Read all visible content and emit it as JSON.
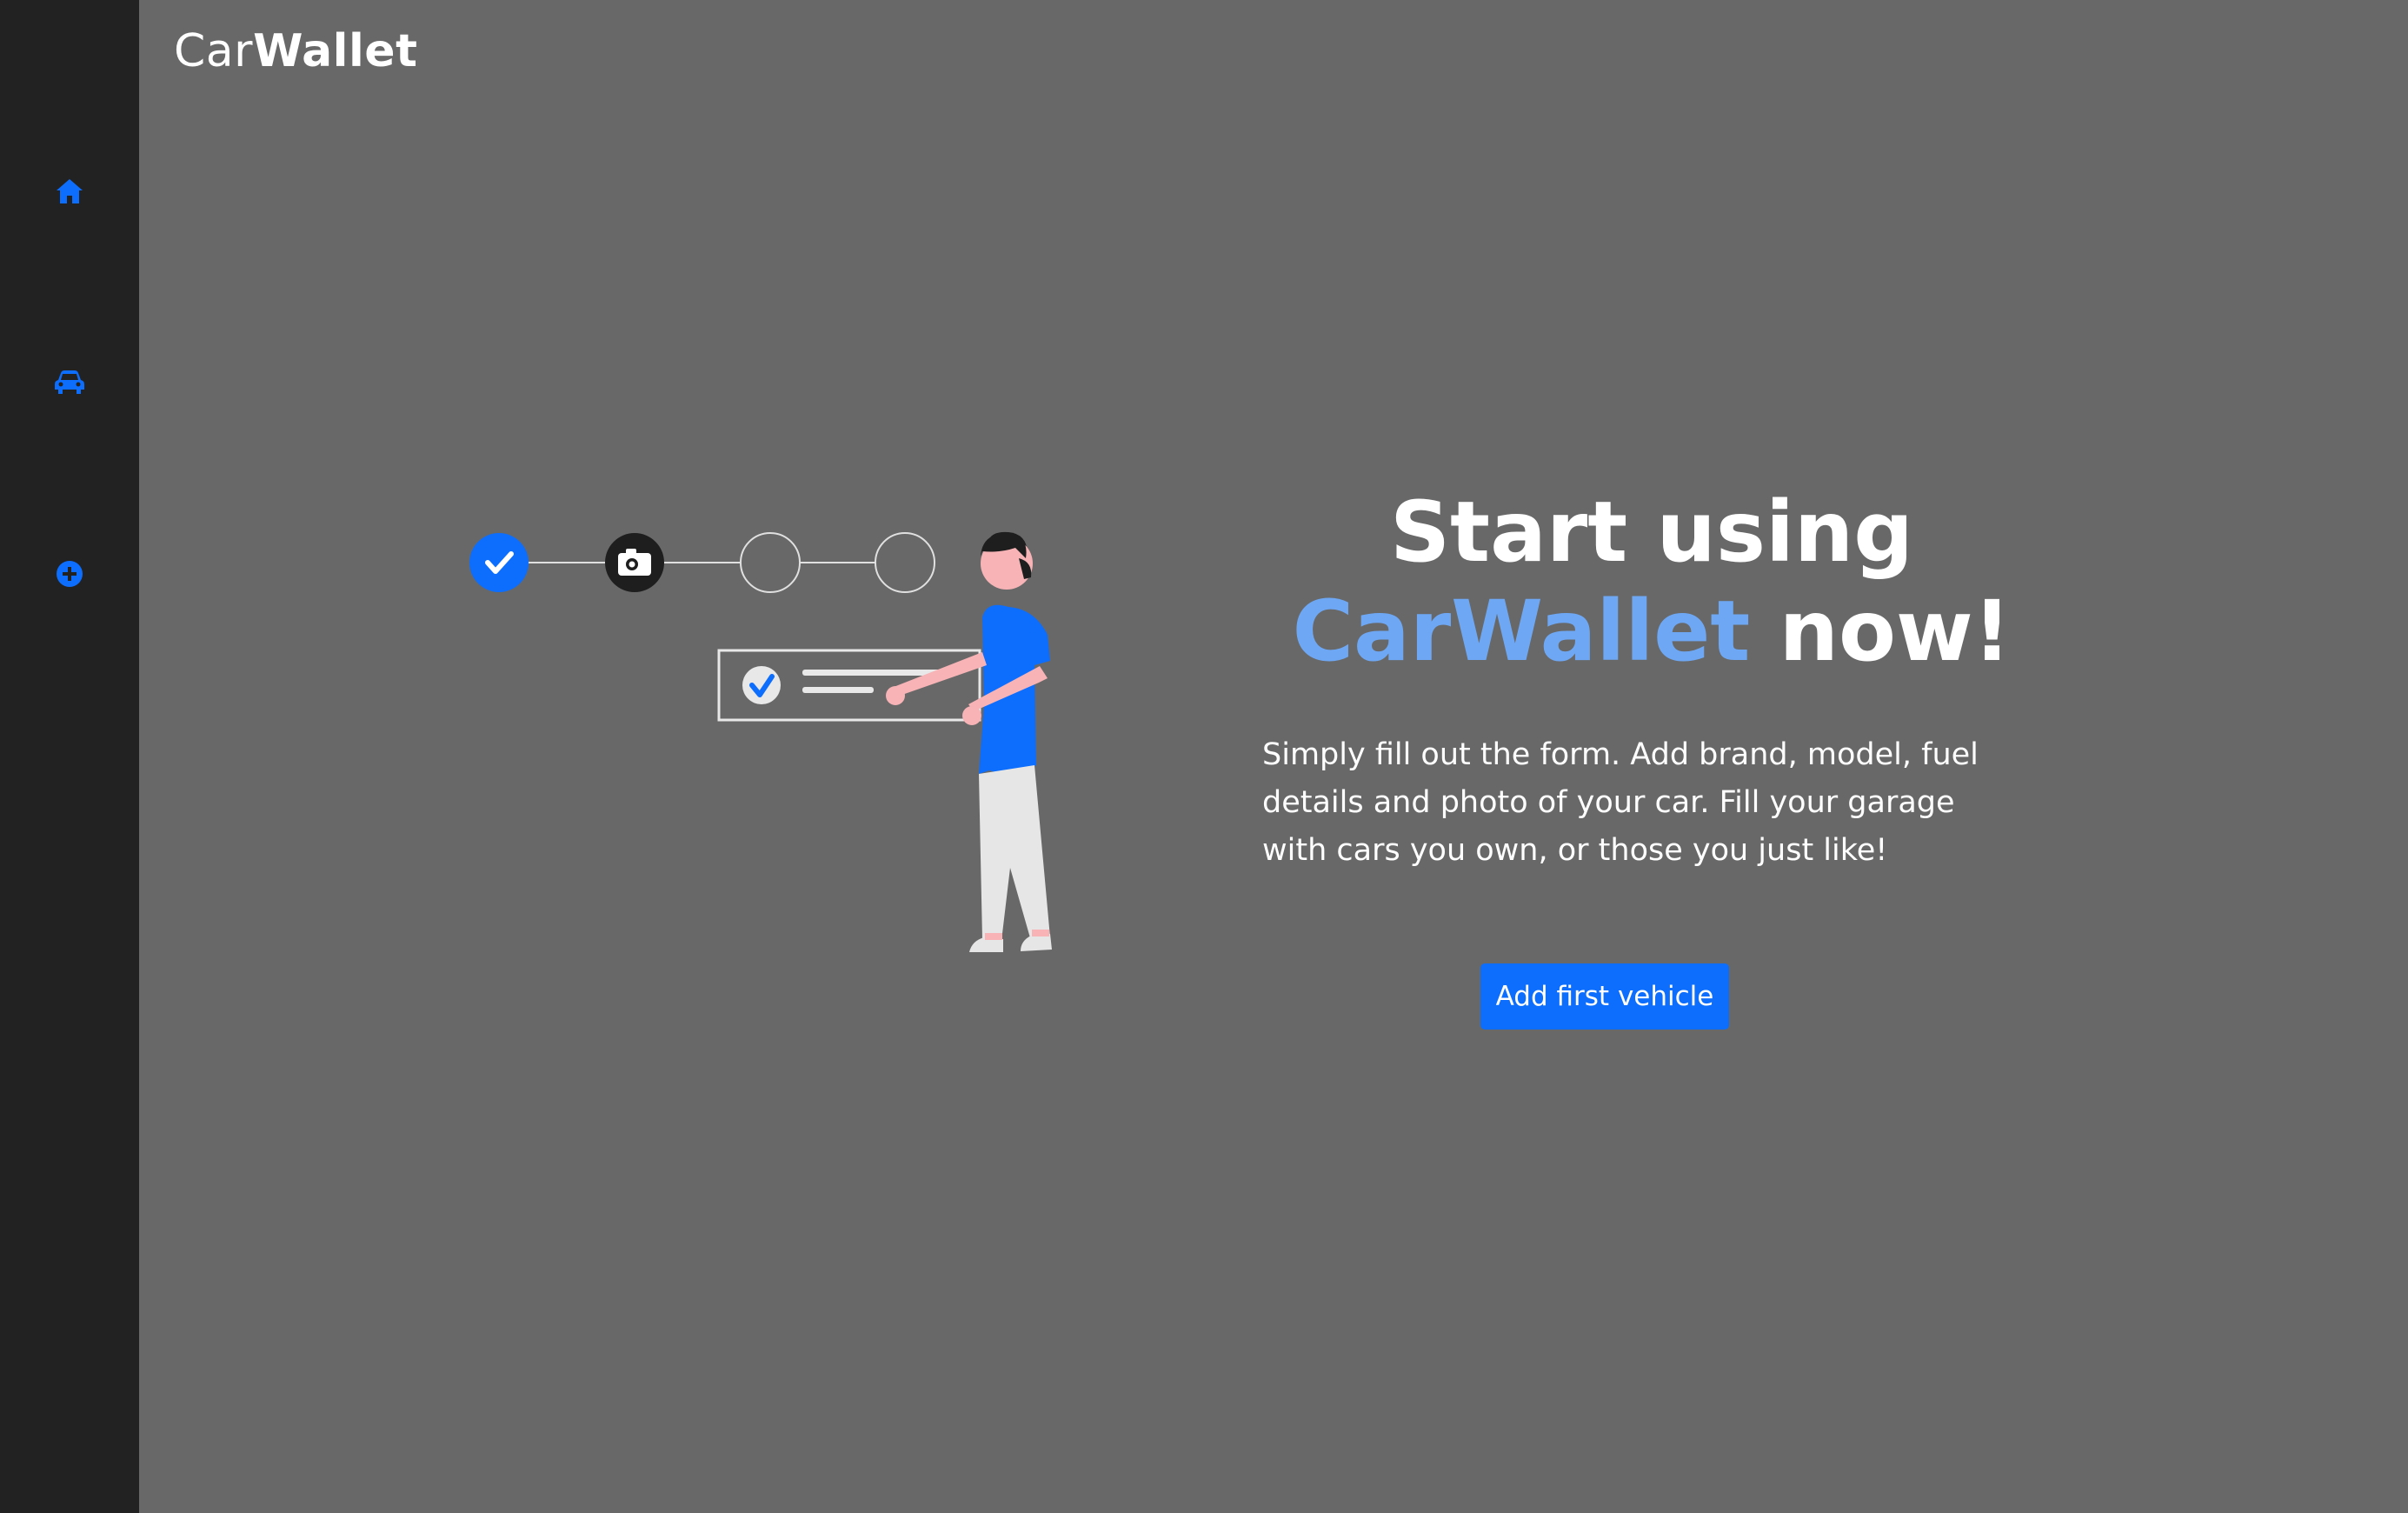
{
  "app": {
    "logo_light": "Car",
    "logo_bold": "Wallet"
  },
  "sidebar": {
    "items": [
      {
        "icon": "home-icon",
        "label": "Home"
      },
      {
        "icon": "car-icon",
        "label": "Vehicles"
      },
      {
        "icon": "plus-circle-icon",
        "label": "Add vehicle"
      }
    ]
  },
  "hero": {
    "title_line1": "Start using",
    "title_accent": "CarWallet",
    "title_rest": " now!",
    "description": "Simply fill out the form. Add brand, model, fuel details and photo of your car. Fill your garage with cars you own, or those you just like!",
    "cta_label": "Add first vehicle"
  },
  "illustration": {
    "steps": [
      "done",
      "photo",
      "empty",
      "empty"
    ]
  },
  "colors": {
    "accent": "#0d6efd",
    "accent_light": "#6ea8f5",
    "sidebar_bg": "#222222",
    "page_bg": "#686868"
  }
}
